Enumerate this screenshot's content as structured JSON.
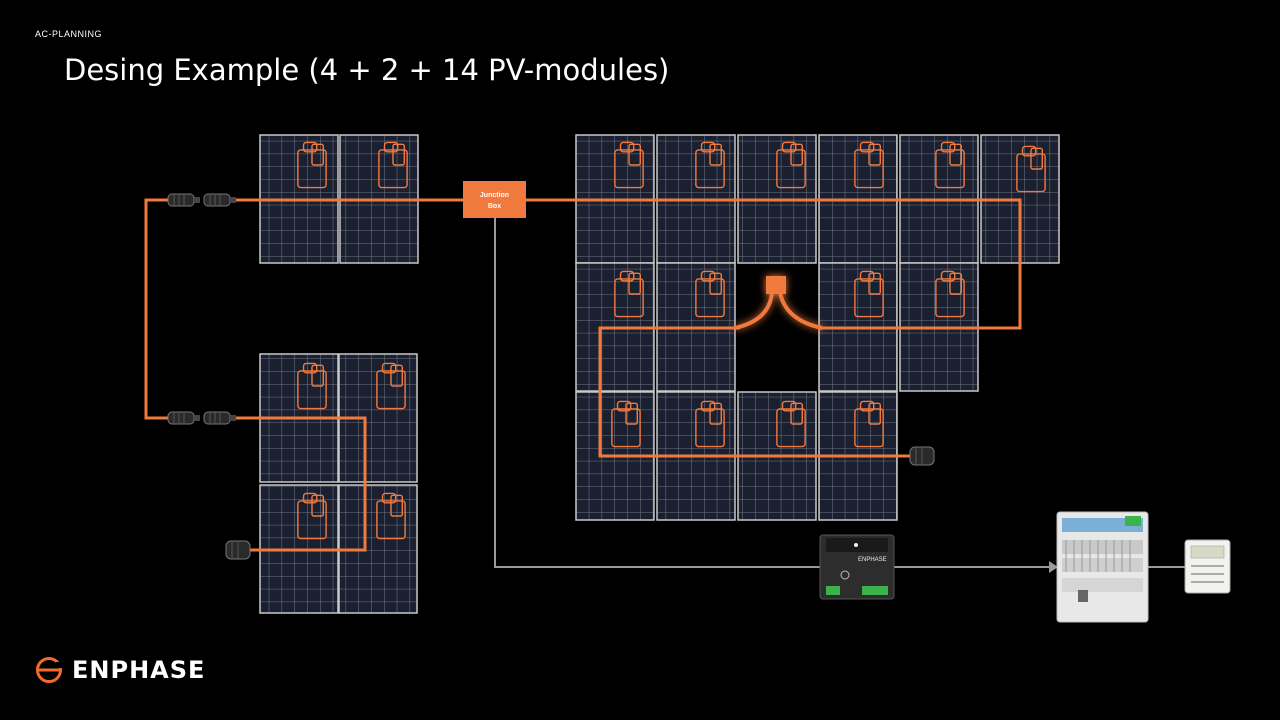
{
  "header": {
    "section_label": "AC-PLANNING",
    "title": "Desing Example (4 + 2 + 14 PV-modules)"
  },
  "junction_box": {
    "label_line1": "Junction",
    "label_line2": "Box"
  },
  "gateway": {
    "brand_label": "ENPHASE"
  },
  "logo": {
    "text": "ENPHASE"
  },
  "colors": {
    "cable": "#f07a3e",
    "panel_frame": "#c9c9c9",
    "accent": "#f26b2b"
  }
}
